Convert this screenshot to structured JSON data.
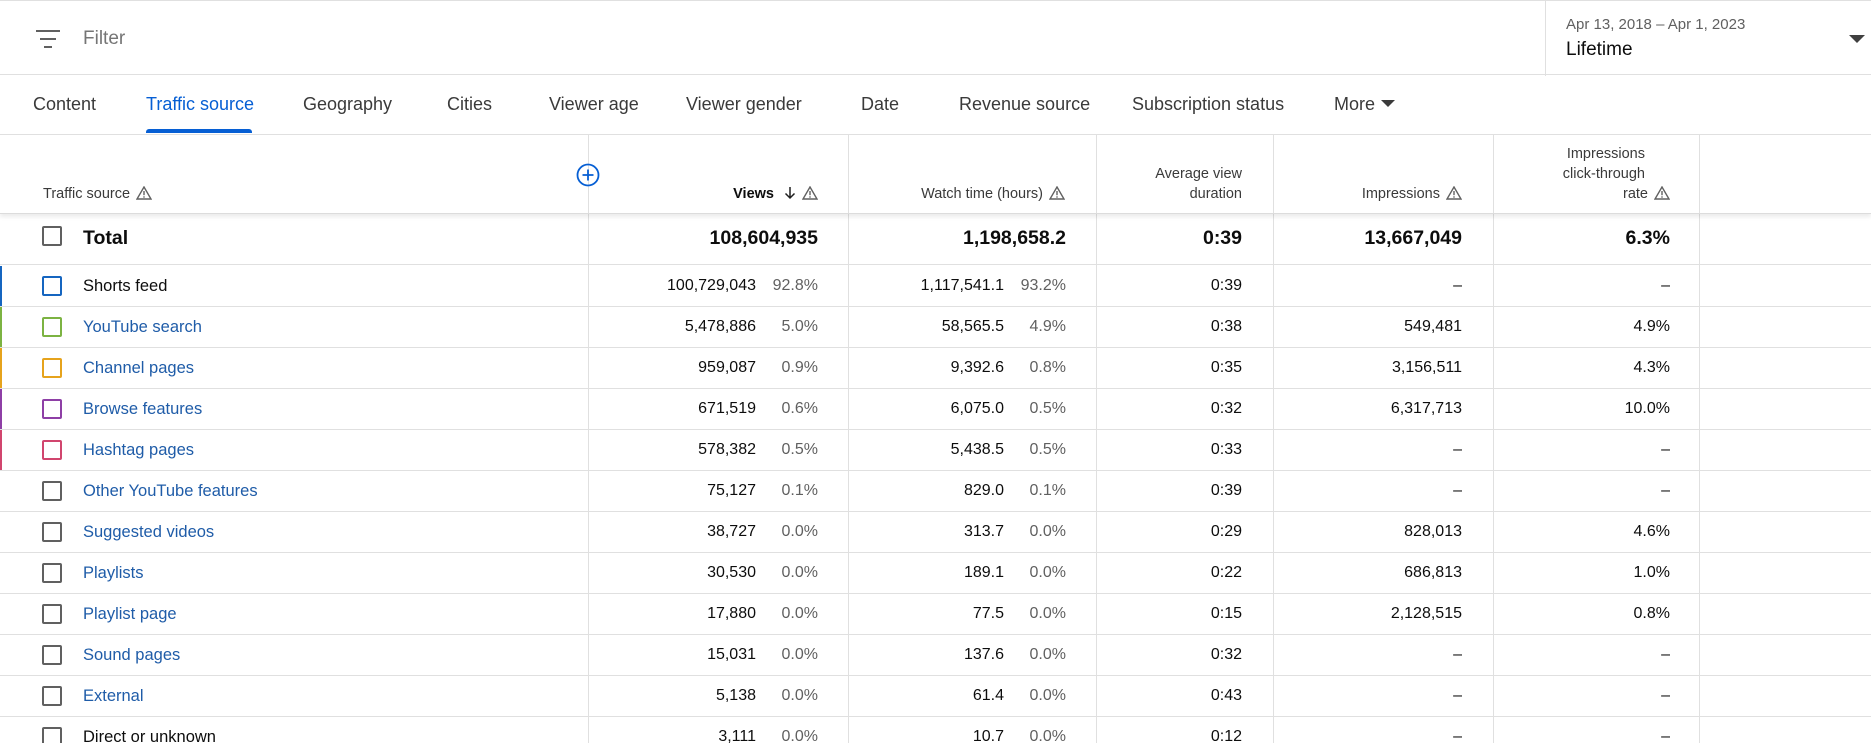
{
  "filter": {
    "placeholder": "Filter"
  },
  "date": {
    "range": "Apr 13, 2018 – Apr 1, 2023",
    "preset": "Lifetime"
  },
  "tabs": [
    {
      "label": "Content"
    },
    {
      "label": "Traffic source",
      "active": true
    },
    {
      "label": "Geography"
    },
    {
      "label": "Cities"
    },
    {
      "label": "Viewer age"
    },
    {
      "label": "Viewer gender"
    },
    {
      "label": "Date"
    },
    {
      "label": "Revenue source"
    },
    {
      "label": "Subscription status"
    },
    {
      "label": "More"
    }
  ],
  "columns": {
    "source": "Traffic source",
    "views": "Views",
    "watch_time": "Watch time (hours)",
    "avd_line1": "Average view",
    "avd_line2": "duration",
    "impressions": "Impressions",
    "ctr_line1": "Impressions",
    "ctr_line2": "click-through",
    "ctr_line3": "rate"
  },
  "total": {
    "label": "Total",
    "views": "108,604,935",
    "watch_time": "1,198,658.2",
    "avd": "0:39",
    "impressions": "13,667,049",
    "ctr": "6.3%"
  },
  "rows": [
    {
      "name": "Shorts feed",
      "link": false,
      "color": "#1565c0",
      "views": "100,729,043",
      "views_pct": "92.8%",
      "watch": "1,117,541.1",
      "watch_pct": "93.2%",
      "avd": "0:39",
      "impressions": "–",
      "ctr": "–"
    },
    {
      "name": "YouTube search",
      "link": true,
      "color": "#7cb342",
      "views": "5,478,886",
      "views_pct": "5.0%",
      "watch": "58,565.5",
      "watch_pct": "4.9%",
      "avd": "0:38",
      "impressions": "549,481",
      "ctr": "4.9%"
    },
    {
      "name": "Channel pages",
      "link": true,
      "color": "#e6a31c",
      "views": "959,087",
      "views_pct": "0.9%",
      "watch": "9,392.6",
      "watch_pct": "0.8%",
      "avd": "0:35",
      "impressions": "3,156,511",
      "ctr": "4.3%"
    },
    {
      "name": "Browse features",
      "link": true,
      "color": "#8e3fa6",
      "views": "671,519",
      "views_pct": "0.6%",
      "watch": "6,075.0",
      "watch_pct": "0.5%",
      "avd": "0:32",
      "impressions": "6,317,713",
      "ctr": "10.0%"
    },
    {
      "name": "Hashtag pages",
      "link": true,
      "color": "#d1456e",
      "views": "578,382",
      "views_pct": "0.5%",
      "watch": "5,438.5",
      "watch_pct": "0.5%",
      "avd": "0:33",
      "impressions": "–",
      "ctr": "–"
    },
    {
      "name": "Other YouTube features",
      "link": true,
      "color": "",
      "views": "75,127",
      "views_pct": "0.1%",
      "watch": "829.0",
      "watch_pct": "0.1%",
      "avd": "0:39",
      "impressions": "–",
      "ctr": "–"
    },
    {
      "name": "Suggested videos",
      "link": true,
      "color": "",
      "views": "38,727",
      "views_pct": "0.0%",
      "watch": "313.7",
      "watch_pct": "0.0%",
      "avd": "0:29",
      "impressions": "828,013",
      "ctr": "4.6%"
    },
    {
      "name": "Playlists",
      "link": true,
      "color": "",
      "views": "30,530",
      "views_pct": "0.0%",
      "watch": "189.1",
      "watch_pct": "0.0%",
      "avd": "0:22",
      "impressions": "686,813",
      "ctr": "1.0%"
    },
    {
      "name": "Playlist page",
      "link": true,
      "color": "",
      "views": "17,880",
      "views_pct": "0.0%",
      "watch": "77.5",
      "watch_pct": "0.0%",
      "avd": "0:15",
      "impressions": "2,128,515",
      "ctr": "0.8%"
    },
    {
      "name": "Sound pages",
      "link": true,
      "color": "",
      "views": "15,031",
      "views_pct": "0.0%",
      "watch": "137.6",
      "watch_pct": "0.0%",
      "avd": "0:32",
      "impressions": "–",
      "ctr": "–"
    },
    {
      "name": "External",
      "link": true,
      "color": "",
      "views": "5,138",
      "views_pct": "0.0%",
      "watch": "61.4",
      "watch_pct": "0.0%",
      "avd": "0:43",
      "impressions": "–",
      "ctr": "–"
    },
    {
      "name": "Direct or unknown",
      "link": false,
      "color": "",
      "views": "3,111",
      "views_pct": "0.0%",
      "watch": "10.7",
      "watch_pct": "0.0%",
      "avd": "0:12",
      "impressions": "–",
      "ctr": "–"
    }
  ],
  "icons": {
    "filter": "filter-icon",
    "warning": "warning-icon",
    "sort": "arrow-down-icon",
    "add_column": "add-circle-icon",
    "dropdown": "caret-down-icon"
  },
  "colors": {
    "accent": "#065fd4",
    "link": "#1f5ca8"
  }
}
